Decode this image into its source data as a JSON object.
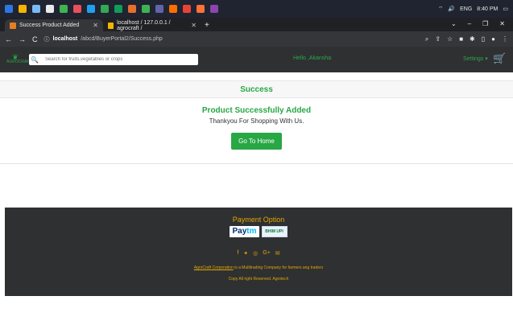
{
  "taskbar": {
    "time": "8:40 PM",
    "lang": "ENG",
    "icon_colors": [
      "#2b78e4",
      "#f4b400",
      "#7ab8f5",
      "#e8eaed",
      "#3fb34f",
      "#e8505b",
      "#1fa1f1",
      "#34a853",
      "#0f9d58",
      "#e66e2f",
      "#3fb34f",
      "#6264a7",
      "#ff6d00",
      "#ea4335",
      "#ff7139",
      "#8e44ad"
    ]
  },
  "tabs": [
    {
      "title": "Success Product Added",
      "favicon_color": "#e67e22"
    },
    {
      "title": "localhost / 127.0.0.1 / agrocraft /",
      "favicon_color": "#f4b400"
    }
  ],
  "address": {
    "host": "localhost",
    "path": "/abcd/BuyerPortal2/Success.php"
  },
  "navbar": {
    "logo_text": "AGROCRAFT",
    "search_placeholder": "Search for fruits,vegetables or crops",
    "hello": "Hello ,Akansha",
    "settings": "Settings",
    "cart_icon": "cart-icon"
  },
  "main": {
    "header": "Success",
    "title": "Product Successfully Added",
    "message": "Thankyou For Shopping With Us.",
    "button": "Go To Home"
  },
  "footer": {
    "payment_title": "Payment Option",
    "paytm_a": "Pay",
    "paytm_b": "tm",
    "upi_label": "BHIM UPI",
    "corp_link": "AgroCraft Corporation",
    "corp_text": " is a Multitrading Company for farmers ang traders",
    "copyright": "Copy All right Reserved.  Agrotech"
  }
}
